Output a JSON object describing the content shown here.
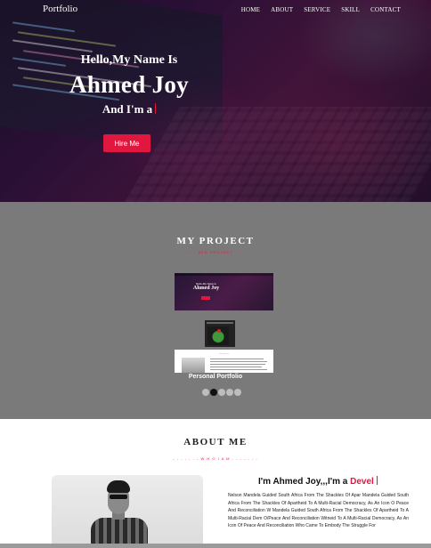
{
  "nav": {
    "brand": "Portfolio",
    "links": [
      "HOME",
      "ABOUT",
      "SERVICE",
      "SKILL",
      "CONTACT"
    ]
  },
  "hero": {
    "greeting": "Hello,My Name Is",
    "name": "Ahmed Joy",
    "iam": "And I'm a",
    "cta": "Hire Me"
  },
  "project": {
    "title": "MY PROJECT",
    "subtitle": "- - - SEE PROJECT - - -",
    "thumb_hello": "Hello,My Name Is",
    "thumb_name": "Ahmed Joy",
    "caption": "Personal Portfolio",
    "slides": 5,
    "active_slide": 2
  },
  "about": {
    "title": "ABOUT ME",
    "subtitle": "- - - - - - - W H O   I   A M - - - - - - -",
    "intro_prefix": "I'm Ahmed Joy,,,I'm a ",
    "intro_role": "Devel",
    "bio": "Nelson Mandela Guided South Africa From The Shackles Of Apar Mandela Guided South Africa From The Shackles Of Apartheid To A Multi-Racial Democracy, As An Icon O Peace And Reconciliation W Mandela Guided South Africa From The Shackles Of Apartheid To A Multi-Racial Dem O/Peace And Reconciliation Witneid To A Multi-Racial Democracy, As An Icon Of Peace And Reconciliation Who Came To Embody The Struggle For"
  },
  "colors": {
    "accent": "#e0183f",
    "project_bg": "#7a7a7a"
  }
}
